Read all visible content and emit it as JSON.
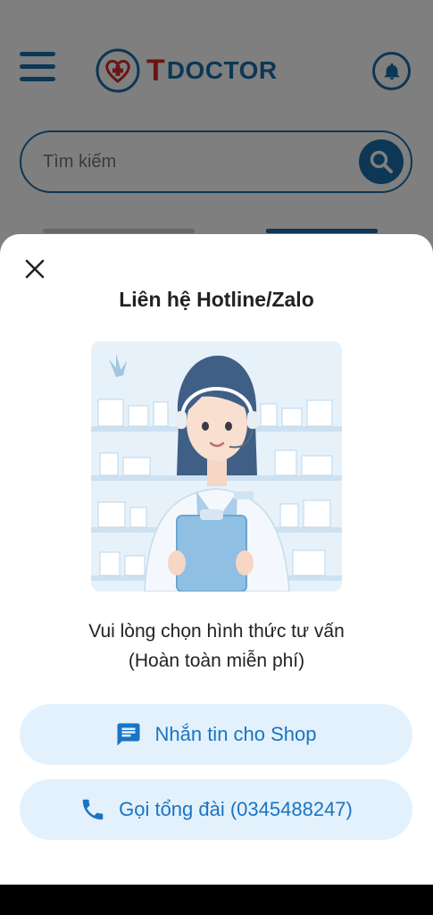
{
  "app": {
    "logo_t": "T",
    "logo_doctor": "DOCTOR",
    "search_placeholder": "Tìm kiếm"
  },
  "icons": {
    "menu": "hamburger-menu-icon",
    "bell": "bell-icon",
    "search": "search-icon",
    "close": "close-icon",
    "chat": "chat-bubble-icon",
    "phone": "phone-icon"
  },
  "colors": {
    "brand_blue": "#1b6fa8",
    "brand_red": "#d62b2b",
    "button_bg": "#e3f1fc",
    "button_text": "#1a74c4"
  },
  "sheet": {
    "title": "Liên hệ Hotline/Zalo",
    "subtitle_line1": "Vui lòng chọn hình thức tư vấn",
    "subtitle_line2": "(Hoàn toàn miễn phí)",
    "chat_label": "Nhắn tin cho Shop",
    "call_label": "Gọi tổng đài (0345488247)"
  }
}
